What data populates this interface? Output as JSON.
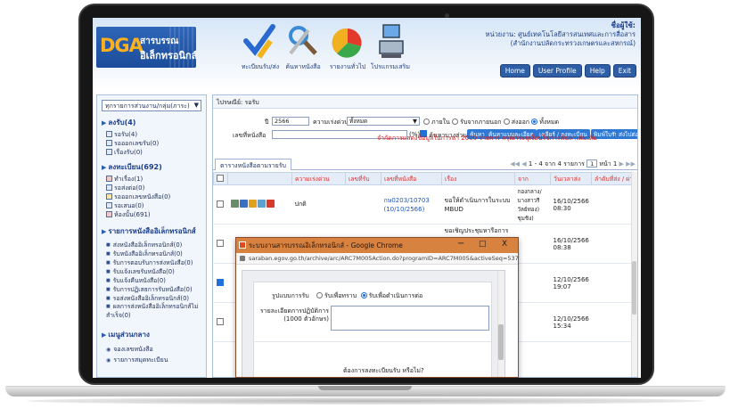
{
  "header": {
    "logo_mark": "DGA",
    "logo_line1": "สารบรรณ",
    "logo_line2": "อิเล็กทรอนิกส์",
    "nav": [
      {
        "label": "ทะเบียนรับ/ส่ง",
        "icon": "check-pencil-icon"
      },
      {
        "label": "ค้นหาหนังสือ",
        "icon": "search-tools-icon"
      },
      {
        "label": "รายงานทั่วไป",
        "icon": "pie-chart-icon"
      },
      {
        "label": "โปรแกรมเสริม",
        "icon": "computer-icon"
      }
    ],
    "user_label": "ชื่อผู้ใช้:",
    "user_org1": "หน่วยงาน: ศูนย์เทคโนโลยีสารสนเทศและการสื่อสาร",
    "user_org2": "(สำนักงานปลัดกระทรวงเกษตรและสหกรณ์)",
    "buttons": [
      "Home",
      "User Profile",
      "Help",
      "Exit"
    ]
  },
  "left": {
    "dept_select": "ทุกรายการส่วนงาน/กลุ่ม(ภาระ)",
    "sections": [
      {
        "title": "ลงรับ(4)",
        "items": [
          "รอรับ(4)",
          "รอออกเลขรับ(0)",
          "เรื่องรับ(0)"
        ]
      },
      {
        "title": "ลงทะเบียน(692)",
        "items": [
          "ทำเรื่อง(1)",
          "รอส่งต่อ(0)",
          "รอออกเลขหนังสือ(0)",
          "รอเสนอ(0)",
          "ห้องนั้น(691)"
        ]
      },
      {
        "title": "รายการหนังสืออิเล็กทรอนิกส์",
        "items": [
          "ส่งหนังสืออิเล็กทรอนิกส์(0)",
          "รับหนังสืออิเล็กทรอนิกส์(0)",
          "รับการตอบรับการส่งหนังสือ(0)",
          "รับแจ้งเลขรับหนังสือ(0)",
          "รับแจ้งคืนหนังสือ(0)",
          "รับการปฏิเสธการรับหนังสือ(0)",
          "รอส่งหนังสืออิเล็กทรอนิกส์(0)",
          "ผลการส่งหนังสืออิเล็กทรอนิกส์ไม่สำเร็จ(0)"
        ]
      },
      {
        "title": "เมนูส่วนกลาง",
        "items": [
          "จองเลขหนังสือ",
          "รายการสมุดทะเบียน"
        ]
      }
    ]
  },
  "main": {
    "crumb": "ไปรษณีย์: รอรับ",
    "search_year_label": "ปี",
    "search_year": "2566",
    "search_urgency_label": "ความเร่งด่วน",
    "search_urgency": "ทั้งหมด",
    "search_origin": [
      "ภายใน",
      "รับจากภายนอก",
      "ส่งออก",
      "ทั้งหมด"
    ],
    "search_doc_label": "เลขที่หนังสือ",
    "search_percent": "(%)",
    "search_check_label": "ค้นหาบางส่วน",
    "search_buttons": [
      "ค้นหา",
      "ค้นหาแบบละเอียด",
      "เคลียร์ / ลงทะเบียน",
      "พิมพ์ใบรับ",
      "ส่งไปต่อ"
    ],
    "warning": "จำกัดการแสดงข้อมูลในการหา 2000 รายการ กรุณาระบุเงื่อนไขการค้นหาเพิ่มเติม",
    "tab": "ตารางหนังสือตามรายรับ",
    "pager": "1 - 4 จาก 4 รายการ",
    "pager_page": "1",
    "pager_total": "หน้า 1",
    "columns": [
      "",
      "",
      "ความเร่งด่วน",
      "เลขที่รับ",
      "เลขที่หนังสือ",
      "เรื่อง",
      "จาก",
      "วันเวลาส่ง",
      "ลำดับที่ส่ง / ผ่านต้นส"
    ],
    "rows": [
      {
        "checked": false,
        "urgency": "ปกติ",
        "docno": "กษ0203/10703 (10/10/2566)",
        "subject": "ขอให้ดำเนินการในระบบ MBUD",
        "from": "กองกลาง/บางสาวรีวัลย์ทอง) ชุมชิง)",
        "date": "16/10/2566 08:30"
      },
      {
        "checked": false,
        "urgency": "",
        "docno": "",
        "subject": "ขอเชิญประชุมหารือการขับ",
        "from": "",
        "date": "16/10/2566 08:38"
      },
      {
        "checked": true,
        "urgency": "",
        "docno": "",
        "subject": "",
        "from": "",
        "date": "12/10/2566 19:07"
      },
      {
        "checked": false,
        "urgency": "",
        "docno": "",
        "subject": "",
        "from": "",
        "date": "12/10/2566 15:34"
      }
    ]
  },
  "popup": {
    "title": "ระบบงานสารบรรณอิเล็กทรอนิกส์ - Google Chrome",
    "url": "saraban.egov.go.th/archive/arc/ARC7M005Action.do?programID=ARC7M005&activeSeq=537055475",
    "controls": [
      "−",
      "□",
      "X"
    ],
    "type_label": "รูปแบบการรับ",
    "options": [
      "รับเพื่อทราบ",
      "รับเพื่อดำเนินการต่อ"
    ],
    "note_label": "รายละเอียดการปฏิบัติการ (1000 ตัวอักษร)",
    "question": "ต้องการลงทะเบียนรับ หรือไม่?"
  }
}
